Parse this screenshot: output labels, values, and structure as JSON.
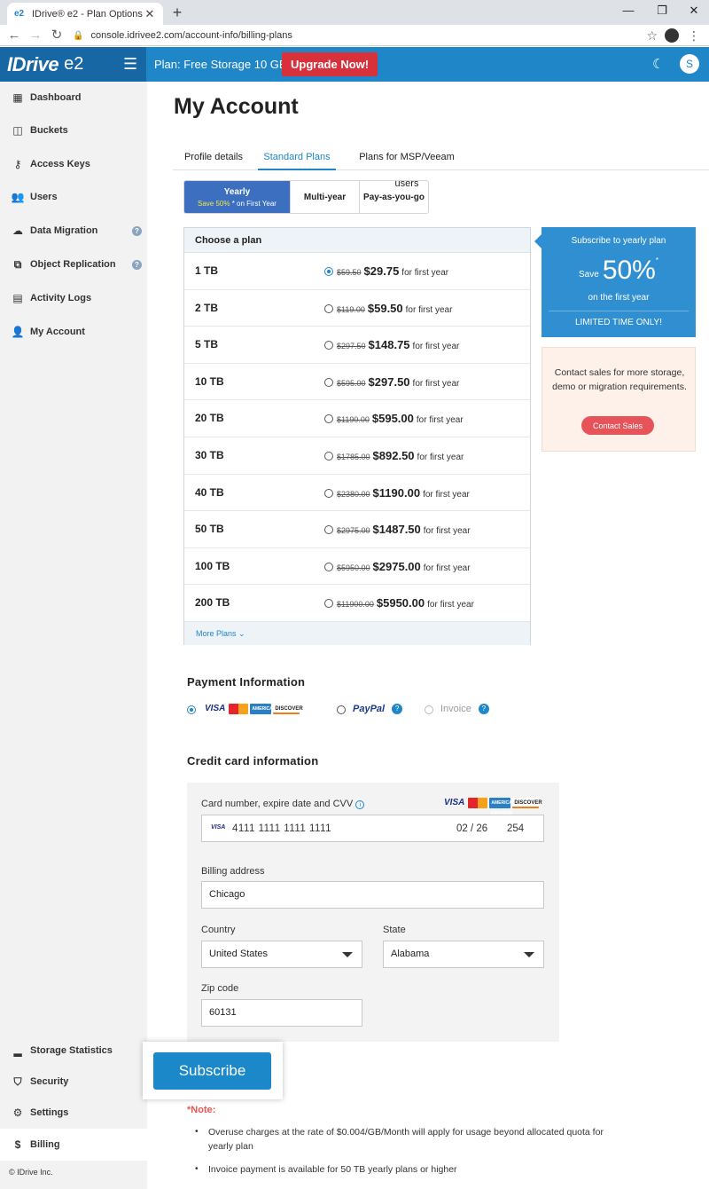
{
  "browser": {
    "tab_title": "IDrive® e2 - Plan Options",
    "favicon": "e2",
    "url": "console.idrivee2.com/account-info/billing-plans"
  },
  "header": {
    "logo": "IDrive",
    "logo_sub": "e2",
    "plan_label": "Plan: Free Storage 10 GB",
    "upgrade_label": "Upgrade Now!",
    "avatar_initial": "S"
  },
  "sidebar": {
    "items": [
      {
        "label": "Dashboard",
        "icon": "dashboard-icon"
      },
      {
        "label": "Buckets",
        "icon": "bucket-icon"
      },
      {
        "label": "Access Keys",
        "icon": "key-icon"
      },
      {
        "label": "Users",
        "icon": "users-icon"
      },
      {
        "label": "Data Migration",
        "icon": "cloud-migration-icon",
        "help": "?"
      },
      {
        "label": "Object Replication",
        "icon": "replication-icon",
        "help": "?"
      },
      {
        "label": "Activity Logs",
        "icon": "log-icon"
      },
      {
        "label": "My Account",
        "icon": "user-icon"
      }
    ],
    "bottom_items": [
      {
        "label": "Storage Statistics",
        "icon": "stats-icon"
      },
      {
        "label": "Security",
        "icon": "shield-icon"
      },
      {
        "label": "Settings",
        "icon": "gear-icon"
      },
      {
        "label": "Billing",
        "icon": "dollar-icon"
      }
    ],
    "footer": "© IDrive Inc."
  },
  "main": {
    "title": "My Account",
    "tabs": [
      {
        "label": "Profile details"
      },
      {
        "label": "Standard Plans"
      },
      {
        "label": "Plans for MSP/Veeam users"
      }
    ],
    "billing_toggle": {
      "yearly": "Yearly",
      "yearly_sub_hl": "Save 50%",
      "yearly_sub_rest": " * on First Year",
      "multi_year": "Multi-year",
      "payg": "Pay-as-you-go"
    },
    "plans": {
      "header": "Choose a plan",
      "per_label": "for first year",
      "rows": [
        {
          "size": "1 TB",
          "old": "$59.50",
          "new": "$29.75",
          "selected": true
        },
        {
          "size": "2 TB",
          "old": "$119.00",
          "new": "$59.50",
          "selected": false
        },
        {
          "size": "5 TB",
          "old": "$297.50",
          "new": "$148.75",
          "selected": false
        },
        {
          "size": "10 TB",
          "old": "$595.00",
          "new": "$297.50",
          "selected": false
        },
        {
          "size": "20 TB",
          "old": "$1190.00",
          "new": "$595.00",
          "selected": false
        },
        {
          "size": "30 TB",
          "old": "$1785.00",
          "new": "$892.50",
          "selected": false
        },
        {
          "size": "40 TB",
          "old": "$2380.00",
          "new": "$1190.00",
          "selected": false
        },
        {
          "size": "50 TB",
          "old": "$2975.00",
          "new": "$1487.50",
          "selected": false
        },
        {
          "size": "100 TB",
          "old": "$5950.00",
          "new": "$2975.00",
          "selected": false
        },
        {
          "size": "200 TB",
          "old": "$11900.00",
          "new": "$5950.00",
          "selected": false
        }
      ],
      "more_plans": "More Plans"
    },
    "promo": {
      "line1": "Subscribe to yearly plan",
      "save_word": "Save",
      "pct": "50%",
      "star": "*",
      "line3": "on the first year",
      "line4": "LIMITED TIME ONLY!"
    },
    "sales": {
      "text": "Contact sales for more storage, demo or migration requirements.",
      "button": "Contact Sales"
    },
    "payment": {
      "title": "Payment Information",
      "visa": "VISA",
      "amex": "AMERICAN EXPRESS",
      "discover": "DISCOVER",
      "paypal": "PayPal",
      "invoice": "Invoice",
      "help": "?"
    },
    "credit_card": {
      "title": "Credit card information",
      "card_label": "Card number, expire date and CVV",
      "info": "i",
      "visa_mini": "VISA",
      "card_number": "4111 1111 1111 1111",
      "expiry": "02 / 26",
      "cvv": "254",
      "billing_label": "Billing address",
      "billing_value": "Chicago",
      "country_label": "Country",
      "country_value": "United States",
      "state_label": "State",
      "state_value": "Alabama",
      "zip_label": "Zip code",
      "zip_value": "60131"
    },
    "subscribe_label": "Subscribe",
    "note": {
      "title": "*Note:",
      "items": [
        "Overuse charges at the rate of $0.004/GB/Month will apply for usage beyond allocated quota for yearly plan",
        "Invoice payment is available for 50 TB yearly plans or higher"
      ]
    }
  },
  "colors": {
    "brand_blue": "#1f86c8",
    "upgrade_red": "#d9313c",
    "toggle_active": "#3c6fc0",
    "note_red": "#e5584f"
  }
}
